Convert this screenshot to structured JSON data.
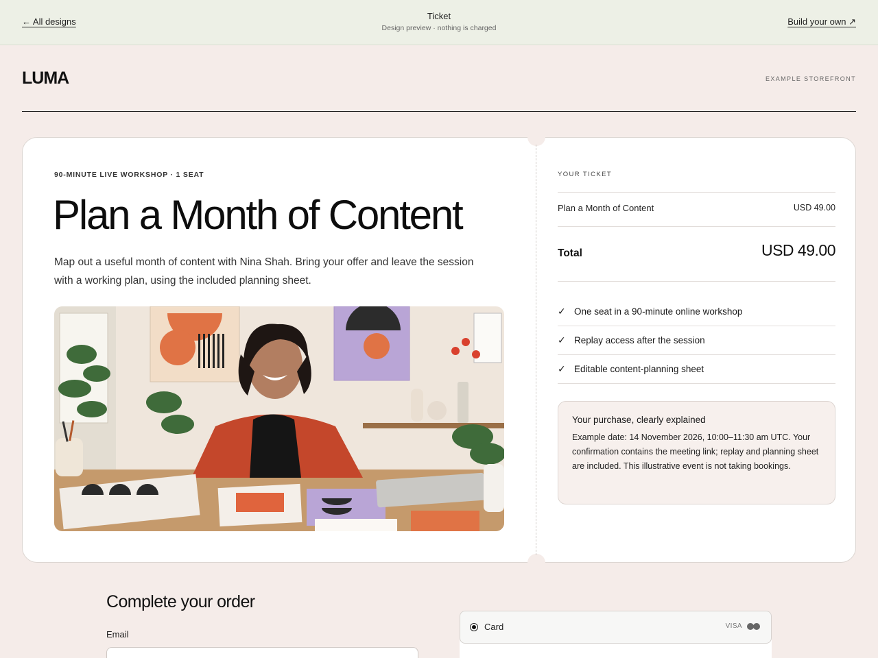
{
  "topbar": {
    "back_label": "← All designs",
    "title": "Ticket",
    "subtitle": "Design preview · nothing is charged",
    "build_label": "Build your own ↗"
  },
  "store": {
    "logo": "LUMA",
    "tag": "EXAMPLE STOREFRONT"
  },
  "event": {
    "eyebrow": "90-MINUTE LIVE WORKSHOP · 1 SEAT",
    "title": "Plan a Month of Content",
    "description": "Map out a useful month of content with Nina Shah. Bring your offer and leave the session with a working plan, using the included planning sheet."
  },
  "ticket": {
    "heading": "YOUR TICKET",
    "item_name": "Plan a Month of Content",
    "item_price": "USD 49.00",
    "total_label": "Total",
    "total_value": "USD 49.00",
    "features": [
      "One seat in a 90-minute online workshop",
      "Replay access after the session",
      "Editable content-planning sheet"
    ],
    "info_title": "Your purchase, clearly explained",
    "info_body": "Example date: 14 November 2026, 10:00–11:30 am UTC. Your confirmation contains the meeting link; replay and planning sheet are included. This illustrative event is not taking bookings."
  },
  "order": {
    "title": "Complete your order",
    "email_label": "Email",
    "email_value": "",
    "payment_option": "Card",
    "card_brand": "VISA"
  },
  "icons": {
    "check": "check-icon",
    "radio": "radio-selected-icon",
    "mastercard": "mastercard-icon"
  }
}
